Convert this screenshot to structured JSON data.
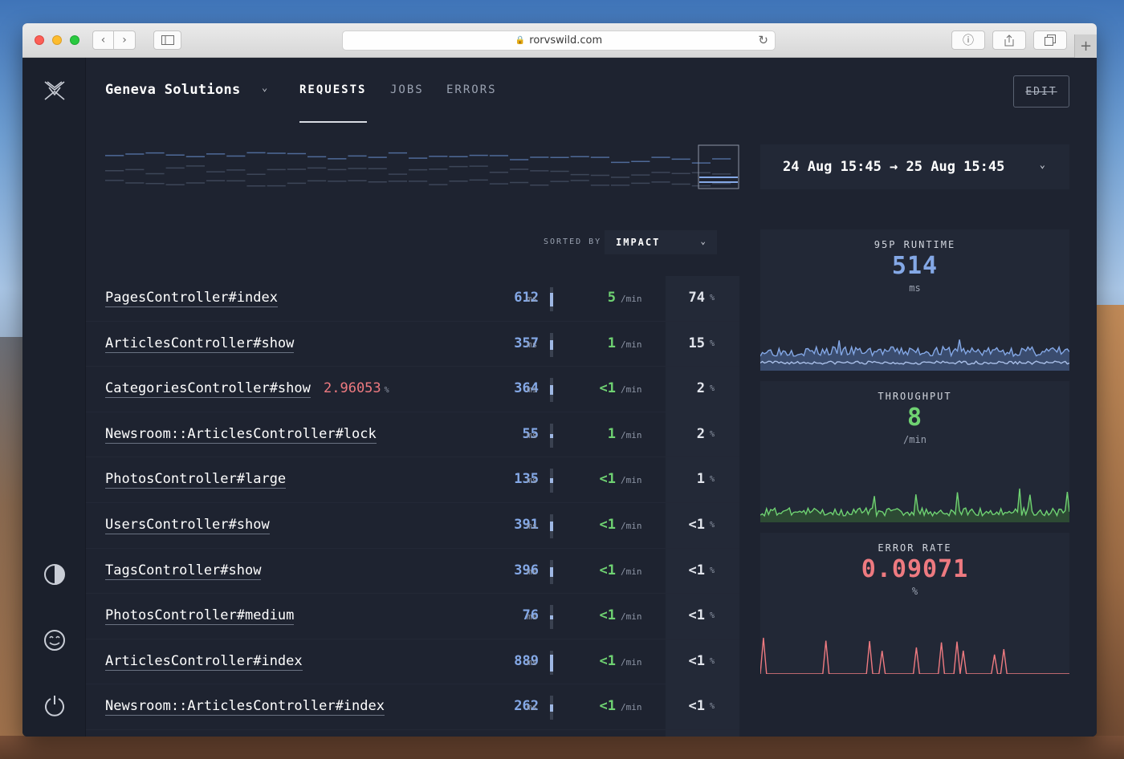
{
  "browser": {
    "url": "rorvswild.com"
  },
  "app": {
    "name": "Geneva Solutions",
    "tabs": [
      {
        "label": "REQUESTS",
        "active": true
      },
      {
        "label": "JOBS",
        "active": false
      },
      {
        "label": "ERRORS",
        "active": false
      }
    ],
    "edit_label": "EDIT"
  },
  "range": {
    "label": "24 Aug 15:45 → 25 Aug 15:45"
  },
  "sort": {
    "label": "SORTED BY",
    "value": "IMPACT"
  },
  "units": {
    "ms": "ms",
    "per_min": "/min",
    "percent": "%"
  },
  "requests": [
    {
      "name": "PagesController#index",
      "runtime": "612",
      "throughput": "5",
      "impact": "74",
      "bar": 0.55
    },
    {
      "name": "ArticlesController#show",
      "runtime": "357",
      "throughput": "1",
      "impact": "15",
      "bar": 0.4
    },
    {
      "name": "CategoriesController#show",
      "error_rate": "2.96053",
      "runtime": "364",
      "throughput": "<1",
      "impact": "2",
      "bar": 0.4
    },
    {
      "name": "Newsroom::ArticlesController#lock",
      "runtime": "55",
      "throughput": "1",
      "impact": "2",
      "bar": 0.15
    },
    {
      "name": "PhotosController#large",
      "runtime": "135",
      "throughput": "<1",
      "impact": "1",
      "bar": 0.2
    },
    {
      "name": "UsersController#show",
      "runtime": "391",
      "throughput": "<1",
      "impact": "<1",
      "bar": 0.4
    },
    {
      "name": "TagsController#show",
      "runtime": "396",
      "throughput": "<1",
      "impact": "<1",
      "bar": 0.4
    },
    {
      "name": "PhotosController#medium",
      "runtime": "76",
      "throughput": "<1",
      "impact": "<1",
      "bar": 0.15
    },
    {
      "name": "ArticlesController#index",
      "runtime": "889",
      "throughput": "<1",
      "impact": "<1",
      "bar": 0.7
    },
    {
      "name": "Newsroom::ArticlesController#index",
      "runtime": "262",
      "throughput": "<1",
      "impact": "<1",
      "bar": 0.3
    }
  ],
  "metrics": {
    "runtime": {
      "label": "95P RUNTIME",
      "value": "514",
      "unit": "ms",
      "color": "#84a8e6"
    },
    "throughput": {
      "label": "THROUGHPUT",
      "value": "8",
      "unit": "/min",
      "color": "#6fd272"
    },
    "error_rate": {
      "label": "ERROR RATE",
      "value": "0.09071",
      "unit": "%",
      "color": "#ee7a80"
    }
  },
  "colors": {
    "background": "#1e2330",
    "sidebar": "#1b202c",
    "accent_blue": "#84a8e6",
    "accent_green": "#6fd272",
    "accent_red": "#ee7a80"
  },
  "icons": {
    "logo": "rorvswild-logo-icon",
    "theme": "half-circle-icon",
    "profile": "smiley-icon",
    "logout": "power-icon"
  }
}
